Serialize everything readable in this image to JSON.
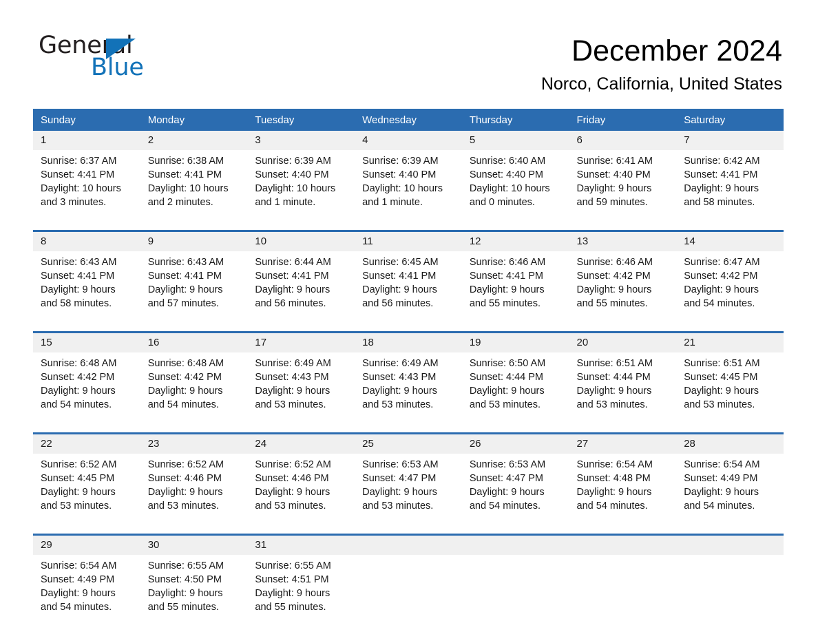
{
  "logo": {
    "word_one": "General",
    "word_two": "Blue",
    "triangle_color": "#1272b8",
    "icon": "general-blue-logo"
  },
  "header": {
    "month_title": "December 2024",
    "location": "Norco, California, United States"
  },
  "theme": {
    "header_blue": "#2b6cb0",
    "rule_blue": "#2b6cb0",
    "daynum_band": "#f0f0f0",
    "text": "#1a1a1a"
  },
  "calendar": {
    "weekday_headers": [
      "Sunday",
      "Monday",
      "Tuesday",
      "Wednesday",
      "Thursday",
      "Friday",
      "Saturday"
    ],
    "weeks": [
      {
        "daynums": [
          "1",
          "2",
          "3",
          "4",
          "5",
          "6",
          "7"
        ],
        "cells": [
          {
            "sunrise": "Sunrise: 6:37 AM",
            "sunset": "Sunset: 4:41 PM",
            "daylight": "Daylight: 10 hours and 3 minutes."
          },
          {
            "sunrise": "Sunrise: 6:38 AM",
            "sunset": "Sunset: 4:41 PM",
            "daylight": "Daylight: 10 hours and 2 minutes."
          },
          {
            "sunrise": "Sunrise: 6:39 AM",
            "sunset": "Sunset: 4:40 PM",
            "daylight": "Daylight: 10 hours and 1 minute."
          },
          {
            "sunrise": "Sunrise: 6:39 AM",
            "sunset": "Sunset: 4:40 PM",
            "daylight": "Daylight: 10 hours and 1 minute."
          },
          {
            "sunrise": "Sunrise: 6:40 AM",
            "sunset": "Sunset: 4:40 PM",
            "daylight": "Daylight: 10 hours and 0 minutes."
          },
          {
            "sunrise": "Sunrise: 6:41 AM",
            "sunset": "Sunset: 4:40 PM",
            "daylight": "Daylight: 9 hours and 59 minutes."
          },
          {
            "sunrise": "Sunrise: 6:42 AM",
            "sunset": "Sunset: 4:41 PM",
            "daylight": "Daylight: 9 hours and 58 minutes."
          }
        ]
      },
      {
        "daynums": [
          "8",
          "9",
          "10",
          "11",
          "12",
          "13",
          "14"
        ],
        "cells": [
          {
            "sunrise": "Sunrise: 6:43 AM",
            "sunset": "Sunset: 4:41 PM",
            "daylight": "Daylight: 9 hours and 58 minutes."
          },
          {
            "sunrise": "Sunrise: 6:43 AM",
            "sunset": "Sunset: 4:41 PM",
            "daylight": "Daylight: 9 hours and 57 minutes."
          },
          {
            "sunrise": "Sunrise: 6:44 AM",
            "sunset": "Sunset: 4:41 PM",
            "daylight": "Daylight: 9 hours and 56 minutes."
          },
          {
            "sunrise": "Sunrise: 6:45 AM",
            "sunset": "Sunset: 4:41 PM",
            "daylight": "Daylight: 9 hours and 56 minutes."
          },
          {
            "sunrise": "Sunrise: 6:46 AM",
            "sunset": "Sunset: 4:41 PM",
            "daylight": "Daylight: 9 hours and 55 minutes."
          },
          {
            "sunrise": "Sunrise: 6:46 AM",
            "sunset": "Sunset: 4:42 PM",
            "daylight": "Daylight: 9 hours and 55 minutes."
          },
          {
            "sunrise": "Sunrise: 6:47 AM",
            "sunset": "Sunset: 4:42 PM",
            "daylight": "Daylight: 9 hours and 54 minutes."
          }
        ]
      },
      {
        "daynums": [
          "15",
          "16",
          "17",
          "18",
          "19",
          "20",
          "21"
        ],
        "cells": [
          {
            "sunrise": "Sunrise: 6:48 AM",
            "sunset": "Sunset: 4:42 PM",
            "daylight": "Daylight: 9 hours and 54 minutes."
          },
          {
            "sunrise": "Sunrise: 6:48 AM",
            "sunset": "Sunset: 4:42 PM",
            "daylight": "Daylight: 9 hours and 54 minutes."
          },
          {
            "sunrise": "Sunrise: 6:49 AM",
            "sunset": "Sunset: 4:43 PM",
            "daylight": "Daylight: 9 hours and 53 minutes."
          },
          {
            "sunrise": "Sunrise: 6:49 AM",
            "sunset": "Sunset: 4:43 PM",
            "daylight": "Daylight: 9 hours and 53 minutes."
          },
          {
            "sunrise": "Sunrise: 6:50 AM",
            "sunset": "Sunset: 4:44 PM",
            "daylight": "Daylight: 9 hours and 53 minutes."
          },
          {
            "sunrise": "Sunrise: 6:51 AM",
            "sunset": "Sunset: 4:44 PM",
            "daylight": "Daylight: 9 hours and 53 minutes."
          },
          {
            "sunrise": "Sunrise: 6:51 AM",
            "sunset": "Sunset: 4:45 PM",
            "daylight": "Daylight: 9 hours and 53 minutes."
          }
        ]
      },
      {
        "daynums": [
          "22",
          "23",
          "24",
          "25",
          "26",
          "27",
          "28"
        ],
        "cells": [
          {
            "sunrise": "Sunrise: 6:52 AM",
            "sunset": "Sunset: 4:45 PM",
            "daylight": "Daylight: 9 hours and 53 minutes."
          },
          {
            "sunrise": "Sunrise: 6:52 AM",
            "sunset": "Sunset: 4:46 PM",
            "daylight": "Daylight: 9 hours and 53 minutes."
          },
          {
            "sunrise": "Sunrise: 6:52 AM",
            "sunset": "Sunset: 4:46 PM",
            "daylight": "Daylight: 9 hours and 53 minutes."
          },
          {
            "sunrise": "Sunrise: 6:53 AM",
            "sunset": "Sunset: 4:47 PM",
            "daylight": "Daylight: 9 hours and 53 minutes."
          },
          {
            "sunrise": "Sunrise: 6:53 AM",
            "sunset": "Sunset: 4:47 PM",
            "daylight": "Daylight: 9 hours and 54 minutes."
          },
          {
            "sunrise": "Sunrise: 6:54 AM",
            "sunset": "Sunset: 4:48 PM",
            "daylight": "Daylight: 9 hours and 54 minutes."
          },
          {
            "sunrise": "Sunrise: 6:54 AM",
            "sunset": "Sunset: 4:49 PM",
            "daylight": "Daylight: 9 hours and 54 minutes."
          }
        ]
      },
      {
        "daynums": [
          "29",
          "30",
          "31",
          "",
          "",
          "",
          ""
        ],
        "cells": [
          {
            "sunrise": "Sunrise: 6:54 AM",
            "sunset": "Sunset: 4:49 PM",
            "daylight": "Daylight: 9 hours and 54 minutes."
          },
          {
            "sunrise": "Sunrise: 6:55 AM",
            "sunset": "Sunset: 4:50 PM",
            "daylight": "Daylight: 9 hours and 55 minutes."
          },
          {
            "sunrise": "Sunrise: 6:55 AM",
            "sunset": "Sunset: 4:51 PM",
            "daylight": "Daylight: 9 hours and 55 minutes."
          },
          {
            "sunrise": "",
            "sunset": "",
            "daylight": ""
          },
          {
            "sunrise": "",
            "sunset": "",
            "daylight": ""
          },
          {
            "sunrise": "",
            "sunset": "",
            "daylight": ""
          },
          {
            "sunrise": "",
            "sunset": "",
            "daylight": ""
          }
        ]
      }
    ]
  }
}
